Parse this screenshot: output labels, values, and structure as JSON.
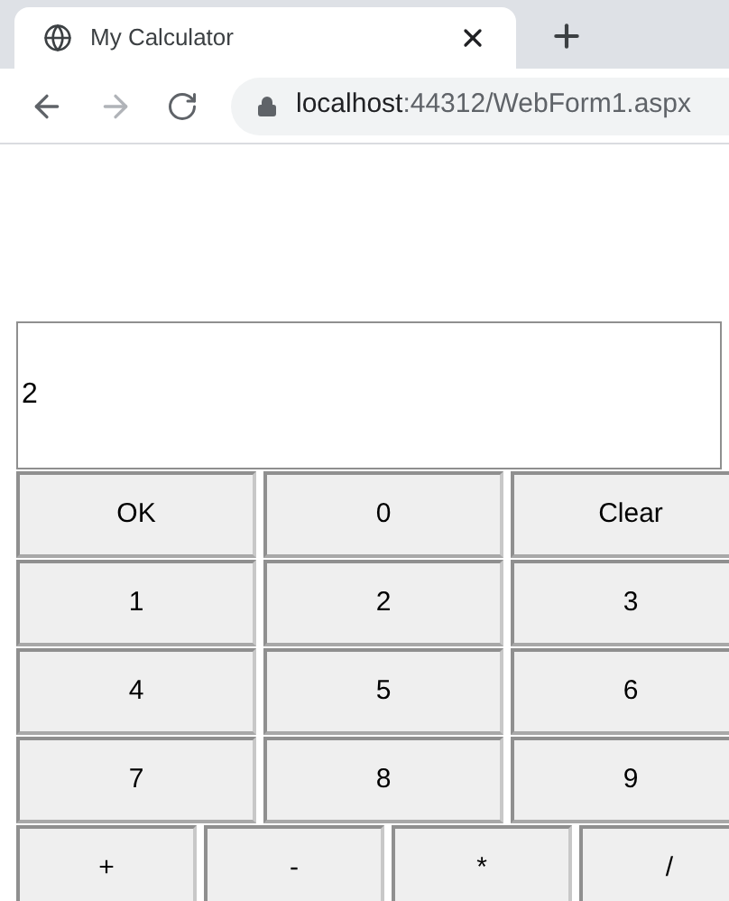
{
  "tab": {
    "title": "My Calculator"
  },
  "address_bar": {
    "host": "localhost",
    "path": ":44312/WebForm1.aspx"
  },
  "nav": {
    "back_disabled": false,
    "forward_disabled": true
  },
  "display": {
    "value": "2"
  },
  "button_rows": [
    [
      "OK",
      "0",
      "Clear"
    ],
    [
      "1",
      "2",
      "3"
    ],
    [
      "4",
      "5",
      "6"
    ],
    [
      "7",
      "8",
      "9"
    ],
    [
      "+",
      "-",
      "*",
      "/"
    ]
  ]
}
